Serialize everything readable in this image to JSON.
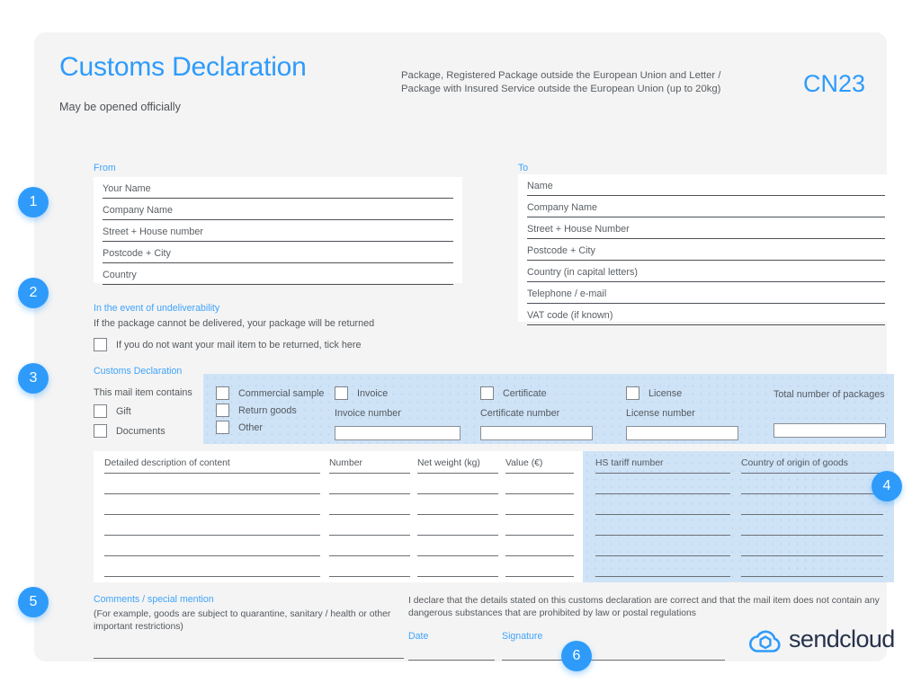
{
  "header": {
    "title": "Customs Declaration",
    "subtitle_line1": "Package, Registered Package outside the European Union and Letter /",
    "subtitle_line2": "Package with Insured Service outside the European Union (up to 20kg)",
    "form_code": "CN23",
    "may_be_opened": "May be opened officially",
    "accent_color": "#2e9bfb"
  },
  "from": {
    "label": "From",
    "fields": [
      "Your Name",
      "Company Name",
      "Street + House number",
      "Postcode + City",
      "Country"
    ]
  },
  "to": {
    "label": "To",
    "fields": [
      "Name",
      "Company Name",
      "Street + House Number",
      "Postcode + City",
      "Country (in capital letters)",
      "Telephone / e-mail",
      "VAT code (if known)"
    ]
  },
  "undeliverability": {
    "label": "In the event of undeliverability",
    "note": "If the package cannot be delivered, your package will be returned",
    "checkbox_label": "If you do not want your mail item to be returned, tick here"
  },
  "customs_declaration": {
    "label": "Customs Declaration",
    "contains_label": "This mail item contains",
    "contains_options": [
      "Gift",
      "Documents"
    ],
    "type_options": [
      "Commercial sample",
      "Return goods",
      "Other"
    ],
    "invoice": {
      "checkbox": "Invoice",
      "number_label": "Invoice number",
      "value": ""
    },
    "certificate": {
      "checkbox": "Certificate",
      "number_label": "Certificate number",
      "value": ""
    },
    "license": {
      "checkbox": "License",
      "number_label": "License number",
      "value": ""
    },
    "total_packages": {
      "label": "Total number of packages",
      "value": ""
    }
  },
  "goods_table": {
    "columns_white": [
      "Detailed description of content",
      "Number",
      "Net weight (kg)",
      "Value (€)"
    ],
    "columns_blue": [
      "HS tariff number",
      "Country of origin of goods"
    ],
    "row_count": 5
  },
  "comments": {
    "label": "Comments / special mention",
    "hint_line1": "(For example, goods are subject to quarantine, sanitary / health or other",
    "hint_line2": "important restrictions)"
  },
  "declaration": {
    "line1": "I declare that the details stated on this customs declaration are correct and that the mail item does not contain any",
    "line2": "dangerous substances that are prohibited by law or postal regulations",
    "date_label": "Date",
    "signature_label": "Signature"
  },
  "logo": {
    "wordmark": "sendcloud",
    "icon": "cloud-box-icon",
    "color": "#2e9bfb"
  },
  "badges": [
    "1",
    "2",
    "3",
    "4",
    "5",
    "6"
  ]
}
